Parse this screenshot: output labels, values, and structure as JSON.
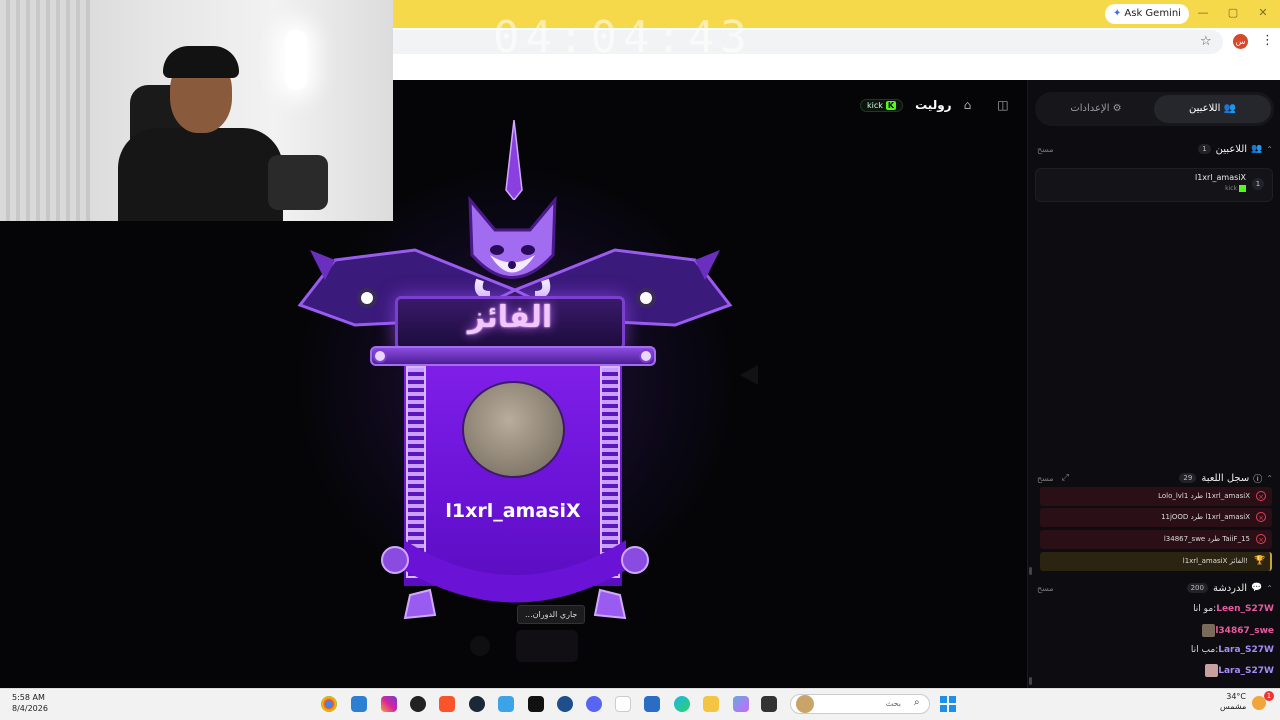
{
  "browser": {
    "ask_gemini": "Ask Gemini",
    "profile_initial": "س",
    "clock_overlay": "04:04:43"
  },
  "stage": {
    "kick_badge": "kick",
    "game_title": "رولیت",
    "winner_label": "الفائز",
    "winner_name": "l1xrl_amasiX",
    "spinning_status": "...جاري الدوران"
  },
  "sidebar": {
    "tabs": {
      "players": "اللاعبين",
      "settings": "الإعدادات"
    },
    "players_section": {
      "title": "اللاعبين",
      "count": "1",
      "clear": "مسح"
    },
    "players": [
      {
        "rank": "1",
        "name": "l1xrl_amasiX",
        "platform": "kick"
      }
    ],
    "game_log": {
      "title": "سجل اللعبة",
      "count": "29",
      "clear": "مسح",
      "entries": [
        {
          "text": "Lolo_lvl1 طرد l1xrl_amasiX",
          "type": "kick"
        },
        {
          "text": "11jOOD طرد l1xrl_amasiX",
          "type": "kick"
        },
        {
          "text": "l34867_swe طرد TaiiF_15",
          "type": "kick"
        },
        {
          "text": "l1xrl_amasiX الفائز!",
          "type": "win"
        }
      ]
    },
    "chat": {
      "title": "الدردشة",
      "count": "200",
      "clear": "مسح",
      "messages": [
        {
          "user": "Leen_S27W",
          "text": "مو انا",
          "avatar": false,
          "color": "#e85aa0"
        },
        {
          "user": "l34867_swe",
          "text": "",
          "avatar": true,
          "color": "#e85aa0"
        },
        {
          "user": "Lara_S27W",
          "text": "مب انا",
          "avatar": false,
          "color": "#a78bfa"
        },
        {
          "user": "Lara_S27W",
          "text": "",
          "avatar": true,
          "color": "#a78bfa"
        }
      ]
    }
  },
  "taskbar": {
    "time": "5:58 AM",
    "date": "8/4/2026",
    "search_placeholder": "بحث",
    "temperature": "34°C",
    "weather_label": "مشمس",
    "notification_count": "1",
    "apps": [
      "chrome-icon",
      "photos-icon",
      "instagram-icon",
      "obs-icon",
      "brave-icon",
      "steam-icon",
      "app-f-icon",
      "capcut-icon",
      "app-blue-icon",
      "discord-icon",
      "app-purple-icon",
      "store-icon",
      "edge-icon",
      "explorer-icon",
      "copilot-icon",
      "terminal-icon"
    ]
  },
  "colors": {
    "accent_purple": "#7f1fe8",
    "kick_green": "#53fc18",
    "browser_bar": "#f6d94a"
  }
}
